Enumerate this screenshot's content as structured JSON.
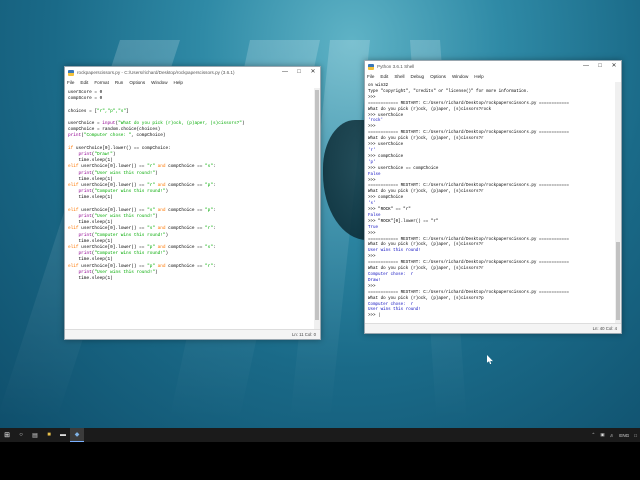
{
  "editor_window": {
    "title": "rockpaperscissors.py - C:/Users/richard/Desktop/rockpaperscissors.py (3.6.1)",
    "menu": [
      "File",
      "Edit",
      "Format",
      "Run",
      "Options",
      "Window",
      "Help"
    ],
    "status": "Ln: 11   Col: 0",
    "code": [
      {
        "parts": [
          {
            "t": "userScore = 0"
          }
        ]
      },
      {
        "parts": [
          {
            "t": "compScore = 0"
          }
        ]
      },
      {
        "parts": [
          {
            "t": ""
          }
        ]
      },
      {
        "parts": [
          {
            "t": "choices = ["
          },
          {
            "t": "\"r\",\"p\",\"s\"",
            "c": "st"
          },
          {
            "t": "]"
          }
        ]
      },
      {
        "parts": [
          {
            "t": ""
          }
        ]
      },
      {
        "parts": [
          {
            "t": "userChoice = "
          },
          {
            "t": "input",
            "c": "bi"
          },
          {
            "t": "("
          },
          {
            "t": "\"What do you pick (r)ock, (p)aper, (s)cissors?\"",
            "c": "st"
          },
          {
            "t": ")"
          }
        ]
      },
      {
        "parts": [
          {
            "t": "compChoice = random.choice(choices)"
          }
        ]
      },
      {
        "parts": [
          {
            "t": "print",
            "c": "bi"
          },
          {
            "t": "("
          },
          {
            "t": "\"Computer chose: \"",
            "c": "st"
          },
          {
            "t": ", compChoice)"
          }
        ]
      },
      {
        "parts": [
          {
            "t": ""
          }
        ]
      },
      {
        "parts": [
          {
            "t": "if",
            "c": "kw"
          },
          {
            "t": " userChoice[0].lower() == compChoice:"
          }
        ]
      },
      {
        "parts": [
          {
            "t": "    "
          },
          {
            "t": "print",
            "c": "bi"
          },
          {
            "t": "("
          },
          {
            "t": "\"Draw!\"",
            "c": "st"
          },
          {
            "t": ")"
          }
        ]
      },
      {
        "parts": [
          {
            "t": "    time.sleep(1)"
          }
        ]
      },
      {
        "parts": [
          {
            "t": "elif",
            "c": "kw"
          },
          {
            "t": " userChoice[0].lower() == "
          },
          {
            "t": "\"r\"",
            "c": "st"
          },
          {
            "t": " "
          },
          {
            "t": "and",
            "c": "kw"
          },
          {
            "t": " compChoice == "
          },
          {
            "t": "\"s\"",
            "c": "st"
          },
          {
            "t": ":"
          }
        ]
      },
      {
        "parts": [
          {
            "t": "    "
          },
          {
            "t": "print",
            "c": "bi"
          },
          {
            "t": "("
          },
          {
            "t": "\"User wins this round!\"",
            "c": "st"
          },
          {
            "t": ")"
          }
        ]
      },
      {
        "parts": [
          {
            "t": "    time.sleep(1)"
          }
        ]
      },
      {
        "parts": [
          {
            "t": "elif",
            "c": "kw"
          },
          {
            "t": " userChoice[0].lower() == "
          },
          {
            "t": "\"r\"",
            "c": "st"
          },
          {
            "t": " "
          },
          {
            "t": "and",
            "c": "kw"
          },
          {
            "t": " compChoice == "
          },
          {
            "t": "\"p\"",
            "c": "st"
          },
          {
            "t": ":"
          }
        ]
      },
      {
        "parts": [
          {
            "t": "    "
          },
          {
            "t": "print",
            "c": "bi"
          },
          {
            "t": "("
          },
          {
            "t": "\"Computer wins this round!\"",
            "c": "st"
          },
          {
            "t": ")"
          }
        ]
      },
      {
        "parts": [
          {
            "t": "    time.sleep(1)"
          }
        ]
      },
      {
        "parts": [
          {
            "t": ""
          }
        ]
      },
      {
        "parts": [
          {
            "t": "elif",
            "c": "kw"
          },
          {
            "t": " userChoice[0].lower() == "
          },
          {
            "t": "\"s\"",
            "c": "st"
          },
          {
            "t": " "
          },
          {
            "t": "and",
            "c": "kw"
          },
          {
            "t": " compChoice == "
          },
          {
            "t": "\"p\"",
            "c": "st"
          },
          {
            "t": ":"
          }
        ]
      },
      {
        "parts": [
          {
            "t": "    "
          },
          {
            "t": "print",
            "c": "bi"
          },
          {
            "t": "("
          },
          {
            "t": "\"User wins this round!\"",
            "c": "st"
          },
          {
            "t": ")"
          }
        ]
      },
      {
        "parts": [
          {
            "t": "    time.sleep(1)"
          }
        ]
      },
      {
        "parts": [
          {
            "t": "elif",
            "c": "kw"
          },
          {
            "t": " userChoice[0].lower() == "
          },
          {
            "t": "\"s\"",
            "c": "st"
          },
          {
            "t": " "
          },
          {
            "t": "and",
            "c": "kw"
          },
          {
            "t": " compChoice == "
          },
          {
            "t": "\"r\"",
            "c": "st"
          },
          {
            "t": ":"
          }
        ]
      },
      {
        "parts": [
          {
            "t": "    "
          },
          {
            "t": "print",
            "c": "bi"
          },
          {
            "t": "("
          },
          {
            "t": "\"Computer wins this round!\"",
            "c": "st"
          },
          {
            "t": ")"
          }
        ]
      },
      {
        "parts": [
          {
            "t": "    time.sleep(1)"
          }
        ]
      },
      {
        "parts": [
          {
            "t": "elif",
            "c": "kw"
          },
          {
            "t": " userChoice[0].lower() == "
          },
          {
            "t": "\"p\"",
            "c": "st"
          },
          {
            "t": " "
          },
          {
            "t": "and",
            "c": "kw"
          },
          {
            "t": " compChoice == "
          },
          {
            "t": "\"s\"",
            "c": "st"
          },
          {
            "t": ":"
          }
        ]
      },
      {
        "parts": [
          {
            "t": "    "
          },
          {
            "t": "print",
            "c": "bi"
          },
          {
            "t": "("
          },
          {
            "t": "\"Computer wins this round!\"",
            "c": "st"
          },
          {
            "t": ")"
          }
        ]
      },
      {
        "parts": [
          {
            "t": "    time.sleep(1)"
          }
        ]
      },
      {
        "parts": [
          {
            "t": "elif",
            "c": "kw"
          },
          {
            "t": " userChoice[0].lower() == "
          },
          {
            "t": "\"p\"",
            "c": "st"
          },
          {
            "t": " "
          },
          {
            "t": "and",
            "c": "kw"
          },
          {
            "t": " compChoice == "
          },
          {
            "t": "\"r\"",
            "c": "st"
          },
          {
            "t": ":"
          }
        ]
      },
      {
        "parts": [
          {
            "t": "    "
          },
          {
            "t": "print",
            "c": "bi"
          },
          {
            "t": "("
          },
          {
            "t": "\"User wins this round!\"",
            "c": "st"
          },
          {
            "t": ")"
          }
        ]
      },
      {
        "parts": [
          {
            "t": "    time.sleep(1)"
          }
        ]
      }
    ]
  },
  "shell_window": {
    "title": "Python 3.6.1 Shell",
    "menu": [
      "File",
      "Edit",
      "Shell",
      "Debug",
      "Options",
      "Window",
      "Help"
    ],
    "status": "Ln: 40   Col: 4",
    "lines": [
      {
        "t": "on win32"
      },
      {
        "t": "Type \"copyright\", \"credits\" or \"license()\" for more information."
      },
      {
        "t": ">>> "
      },
      {
        "t": "============ RESTART: C:/Users/richard/Desktop/rockpaperscissors.py ============"
      },
      {
        "t": "What do you pick (r)ock, (p)aper, (s)cissors?rock"
      },
      {
        "t": ">>> userChoice"
      },
      {
        "t": "'rock'",
        "c": "shell-out"
      },
      {
        "t": ">>> "
      },
      {
        "t": "============ RESTART: C:/Users/richard/Desktop/rockpaperscissors.py ============"
      },
      {
        "t": "What do you pick (r)ock, (p)aper, (s)cissors?r"
      },
      {
        "t": ">>> userChoice"
      },
      {
        "t": "'r'",
        "c": "shell-out"
      },
      {
        "t": ">>> compChoice"
      },
      {
        "t": "'p'",
        "c": "shell-out"
      },
      {
        "t": ">>> userChoice == compChoice"
      },
      {
        "t": "False",
        "c": "shell-out"
      },
      {
        "t": ">>> "
      },
      {
        "t": "============ RESTART: C:/Users/richard/Desktop/rockpaperscissors.py ============"
      },
      {
        "t": "What do you pick (r)ock, (p)aper, (s)cissors?r"
      },
      {
        "t": ">>> compChoice"
      },
      {
        "t": "'s'",
        "c": "shell-out"
      },
      {
        "t": ">>> \"ROCK\" == \"r\""
      },
      {
        "t": "False",
        "c": "shell-out"
      },
      {
        "t": ">>> \"ROCK\"[0].lower() == \"r\""
      },
      {
        "t": "True",
        "c": "shell-out"
      },
      {
        "t": ">>> "
      },
      {
        "t": "============ RESTART: C:/Users/richard/Desktop/rockpaperscissors.py ============"
      },
      {
        "t": "What do you pick (r)ock, (p)aper, (s)cissors?r"
      },
      {
        "t": "User wins this round!",
        "c": "shell-out"
      },
      {
        "t": ">>> "
      },
      {
        "t": "============ RESTART: C:/Users/richard/Desktop/rockpaperscissors.py ============"
      },
      {
        "t": "What do you pick (r)ock, (p)aper, (s)cissors?r"
      },
      {
        "t": "Computer chose:  r",
        "c": "shell-out"
      },
      {
        "t": "Draw!",
        "c": "shell-out"
      },
      {
        "t": ">>> "
      },
      {
        "t": "============ RESTART: C:/Users/richard/Desktop/rockpaperscissors.py ============"
      },
      {
        "t": "What do you pick (r)ock, (p)aper, (s)cissors?p"
      },
      {
        "t": "Computer chose:  r",
        "c": "shell-out"
      },
      {
        "t": "User wins this round!",
        "c": "shell-out"
      },
      {
        "t": ">>> |"
      }
    ]
  },
  "taskbar": {
    "lang": "ENG",
    "tray_icons": [
      "chevron-up-icon",
      "network-icon",
      "volume-icon"
    ]
  }
}
